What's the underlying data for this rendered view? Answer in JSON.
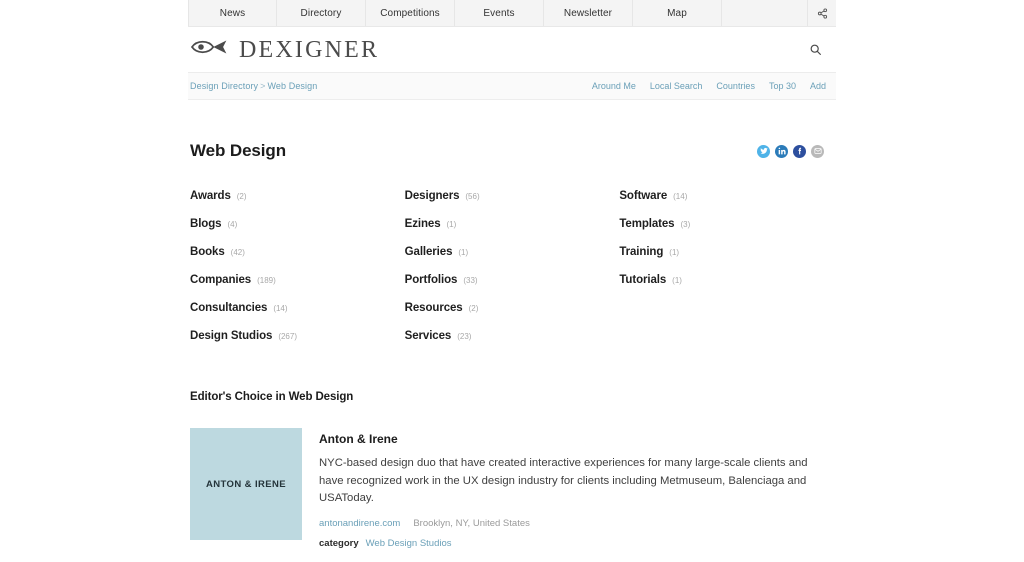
{
  "topnav": {
    "items": [
      {
        "label": "News"
      },
      {
        "label": "Directory"
      },
      {
        "label": "Competitions"
      },
      {
        "label": "Events"
      },
      {
        "label": "Newsletter"
      },
      {
        "label": "Map"
      }
    ],
    "share_icon": "share-icon"
  },
  "header": {
    "logo_text": "DEXIGNER",
    "logo_icon": "fish-eye-logo-icon",
    "search_icon": "search-icon"
  },
  "breadcrumb": {
    "root": "Design Directory",
    "separator": ">",
    "current": "Web Design",
    "actions": [
      {
        "label": "Around Me"
      },
      {
        "label": "Local Search"
      },
      {
        "label": "Countries"
      },
      {
        "label": "Top 30"
      },
      {
        "label": "Add"
      }
    ]
  },
  "page": {
    "title": "Web Design"
  },
  "share": {
    "items": [
      {
        "name": "twitter-share-icon",
        "color": "#4fb3e8"
      },
      {
        "name": "linkedin-share-icon",
        "color": "#2b7bb9"
      },
      {
        "name": "facebook-share-icon",
        "color": "#2d4f9e"
      },
      {
        "name": "email-share-icon",
        "color": "#b9b9b9"
      }
    ]
  },
  "categories": {
    "columns": [
      [
        {
          "label": "Awards",
          "count": "(2)"
        },
        {
          "label": "Blogs",
          "count": "(4)"
        },
        {
          "label": "Books",
          "count": "(42)"
        },
        {
          "label": "Companies",
          "count": "(189)"
        },
        {
          "label": "Consultancies",
          "count": "(14)"
        },
        {
          "label": "Design Studios",
          "count": "(267)"
        }
      ],
      [
        {
          "label": "Designers",
          "count": "(56)"
        },
        {
          "label": "Ezines",
          "count": "(1)"
        },
        {
          "label": "Galleries",
          "count": "(1)"
        },
        {
          "label": "Portfolios",
          "count": "(33)"
        },
        {
          "label": "Resources",
          "count": "(2)"
        },
        {
          "label": "Services",
          "count": "(23)"
        }
      ],
      [
        {
          "label": "Software",
          "count": "(14)"
        },
        {
          "label": "Templates",
          "count": "(3)"
        },
        {
          "label": "Training",
          "count": "(1)"
        },
        {
          "label": "Tutorials",
          "count": "(1)"
        }
      ]
    ]
  },
  "editors_choice": {
    "heading": "Editor's Choice in Web Design",
    "entry": {
      "thumb_text": "ANTON & IRENE",
      "thumb_color": "#bdd9e0",
      "name": "Anton & Irene",
      "description": "NYC-based design duo that have created interactive experiences for many large-scale clients and have recognized work in the UX design industry for clients including Metmuseum, Balenciaga and USAToday.",
      "url": "antonandirene.com",
      "location": "Brooklyn, NY, United States",
      "category_label": "category",
      "category_value": "Web Design Studios"
    }
  }
}
